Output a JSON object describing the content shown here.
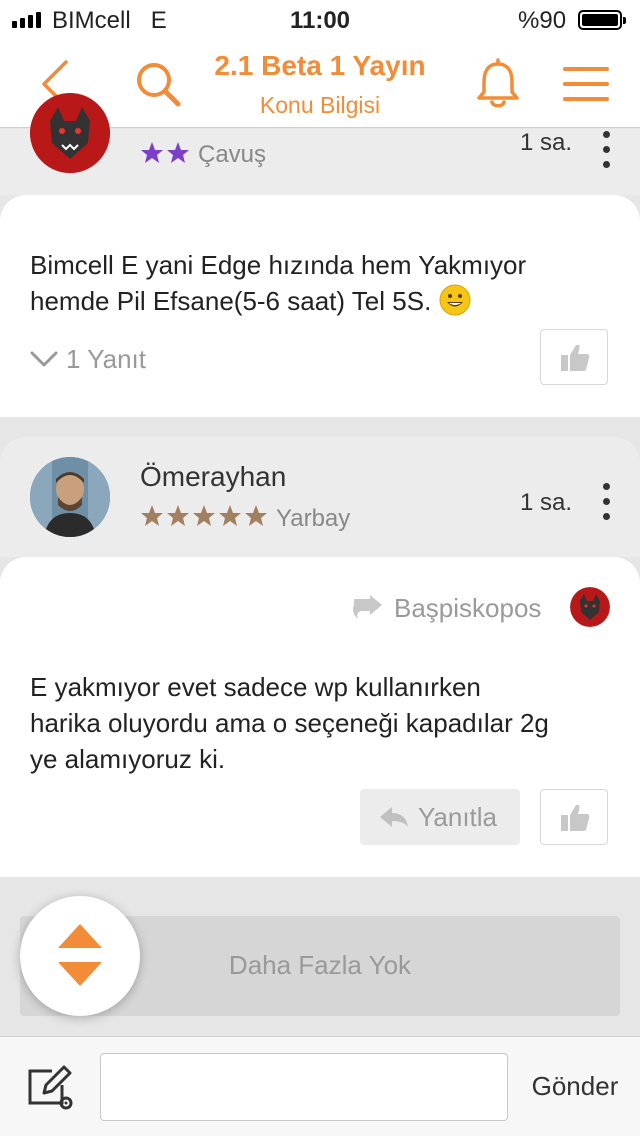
{
  "status_bar": {
    "carrier": "BIMcell",
    "network": "E",
    "time": "11:00",
    "battery": "%90"
  },
  "nav": {
    "title": "2.1 Beta 1 Yayın",
    "subtitle": "Konu Bilgisi",
    "icons": [
      "back-chevron-icon",
      "search-icon",
      "bell-icon",
      "menu-icon"
    ],
    "accent_color": "#f28c38"
  },
  "posts": [
    {
      "rank": "Çavuş",
      "star_count": 2,
      "star_color": "#7b3fc9",
      "time": "1 sa.",
      "message_lines": [
        "Bimcell E yani Edge hızında hem Yakmıyor",
        "hemde Pil Efsane(5-6 saat) Tel 5S."
      ],
      "replies_label": "1 Yanıt"
    },
    {
      "username": "Ömerayhan",
      "rank": "Yarbay",
      "star_count": 5,
      "star_color": "#a08060",
      "time": "1 sa.",
      "quoted_user": "Başpiskopos",
      "message_lines": [
        "E yakmıyor evet sadece wp kullanırken",
        "harika oluyordu ama o seçeneği kapadılar 2g",
        "ye alamıyoruz ki."
      ],
      "reply_label": "Yanıtla"
    }
  ],
  "load_more_label": "Daha Fazla Yok",
  "composer": {
    "placeholder": "",
    "send_label": "Gönder"
  }
}
